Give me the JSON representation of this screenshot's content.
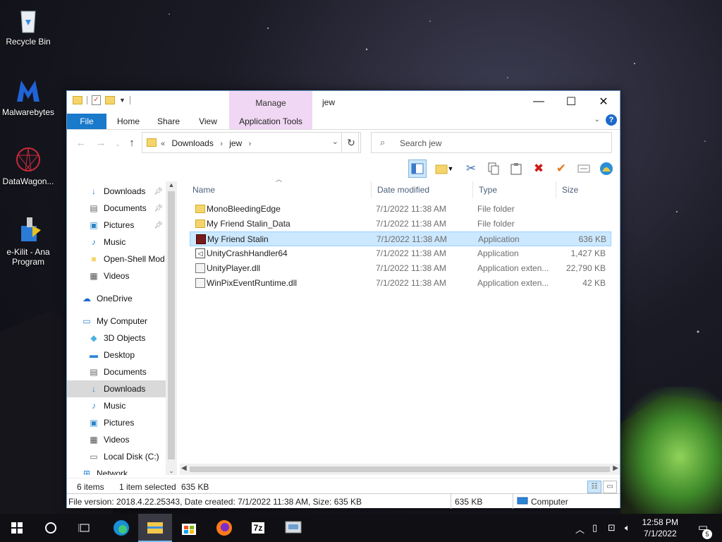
{
  "desktop": {
    "icons": [
      {
        "label": "Recycle Bin",
        "icon": "recycle-bin-icon"
      },
      {
        "label": "Malwarebytes",
        "icon": "malwarebytes-icon"
      },
      {
        "label": "DataWagon...",
        "icon": "datawagon-icon"
      },
      {
        "label": "e-Kilit - Ana Program",
        "icon": "ekilit-icon"
      }
    ]
  },
  "window": {
    "title": "jew",
    "manage_label": "Manage",
    "tabs": {
      "file": "File",
      "home": "Home",
      "share": "Share",
      "view": "View",
      "application_tools": "Application Tools"
    },
    "address": {
      "crumb_prefix": "«",
      "crumbs": [
        "Downloads",
        "jew"
      ]
    },
    "search_placeholder": "Search jew",
    "nav_items": [
      {
        "label": "Downloads",
        "icon": "download-arrow-icon",
        "pinned": true
      },
      {
        "label": "Documents",
        "icon": "documents-icon",
        "pinned": true
      },
      {
        "label": "Pictures",
        "icon": "pictures-icon",
        "pinned": true
      },
      {
        "label": "Music",
        "icon": "music-icon",
        "pinned": false
      },
      {
        "label": "Open-Shell Mod",
        "icon": "folder-icon",
        "pinned": false
      },
      {
        "label": "Videos",
        "icon": "videos-icon",
        "pinned": false
      },
      {
        "label": "OneDrive",
        "icon": "onedrive-icon",
        "pinned": false
      },
      {
        "label": "My Computer",
        "icon": "computer-icon",
        "pinned": false
      },
      {
        "label": "3D Objects",
        "icon": "3d-objects-icon",
        "pinned": false
      },
      {
        "label": "Desktop",
        "icon": "desktop-icon",
        "pinned": false
      },
      {
        "label": "Documents",
        "icon": "documents-icon",
        "pinned": false
      },
      {
        "label": "Downloads",
        "icon": "download-arrow-icon",
        "pinned": false,
        "selected": true
      },
      {
        "label": "Music",
        "icon": "music-icon",
        "pinned": false
      },
      {
        "label": "Pictures",
        "icon": "pictures-icon",
        "pinned": false
      },
      {
        "label": "Videos",
        "icon": "videos-icon",
        "pinned": false
      },
      {
        "label": "Local Disk (C:)",
        "icon": "disk-icon",
        "pinned": false
      },
      {
        "label": "Network",
        "icon": "network-icon",
        "pinned": false
      }
    ],
    "columns": {
      "name": "Name",
      "date": "Date modified",
      "type": "Type",
      "size": "Size"
    },
    "files": [
      {
        "name": "MonoBleedingEdge",
        "date": "7/1/2022 11:38 AM",
        "type": "File folder",
        "size": "",
        "icon": "folder-icon"
      },
      {
        "name": "My Friend Stalin_Data",
        "date": "7/1/2022 11:38 AM",
        "type": "File folder",
        "size": "",
        "icon": "folder-icon"
      },
      {
        "name": "My Friend Stalin",
        "date": "7/1/2022 11:38 AM",
        "type": "Application",
        "size": "636 KB",
        "icon": "application-icon",
        "selected": true
      },
      {
        "name": "UnityCrashHandler64",
        "date": "7/1/2022 11:38 AM",
        "type": "Application",
        "size": "1,427 KB",
        "icon": "unity-icon"
      },
      {
        "name": "UnityPlayer.dll",
        "date": "7/1/2022 11:38 AM",
        "type": "Application exten...",
        "size": "22,790 KB",
        "icon": "dll-icon"
      },
      {
        "name": "WinPixEventRuntime.dll",
        "date": "7/1/2022 11:38 AM",
        "type": "Application exten...",
        "size": "42 KB",
        "icon": "dll-icon"
      }
    ],
    "status": {
      "items": "6 items",
      "selected": "1 item selected",
      "selected_size": "635 KB",
      "details": "File version: 2018.4.22.25343, Date created: 7/1/2022 11:38 AM, Size: 635 KB",
      "size2": "635 KB",
      "location": "Computer"
    }
  },
  "taskbar": {
    "time": "12:58 PM",
    "date": "7/1/2022",
    "notifications": "5",
    "app_7z": "7z"
  }
}
